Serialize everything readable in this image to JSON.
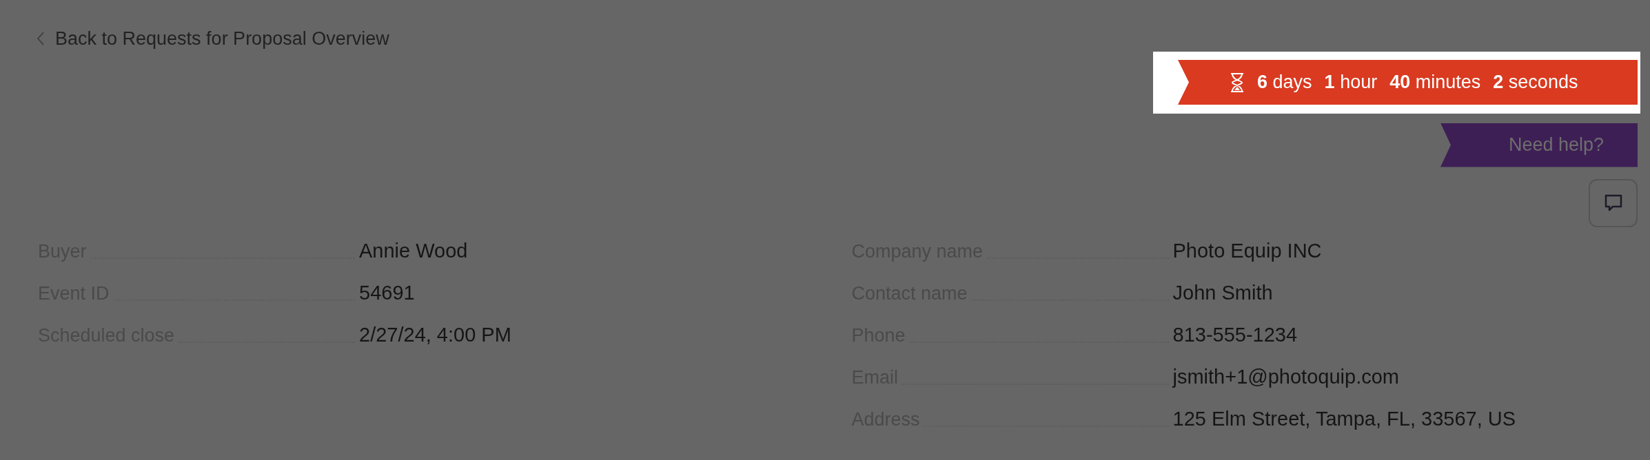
{
  "back_link": {
    "label": "Back to Requests for Proposal Overview"
  },
  "countdown": {
    "segments": [
      {
        "value": "6",
        "unit": "days"
      },
      {
        "value": "1",
        "unit": "hour"
      },
      {
        "value": "40",
        "unit": "minutes"
      },
      {
        "value": "2",
        "unit": "seconds"
      }
    ]
  },
  "help_button": {
    "label": "Need help?"
  },
  "event_details": [
    {
      "label": "Buyer",
      "value": "Annie Wood"
    },
    {
      "label": "Event ID",
      "value": "54691"
    },
    {
      "label": "Scheduled close",
      "value": "2/27/24, 4:00 PM"
    }
  ],
  "supplier_details": [
    {
      "label": "Company name",
      "value": "Photo Equip INC"
    },
    {
      "label": "Contact name",
      "value": "John Smith"
    },
    {
      "label": "Phone",
      "value": "813-555-1234"
    },
    {
      "label": "Email",
      "value": "jsmith+1@photoquip.com"
    },
    {
      "label": "Address",
      "value": "125 Elm Street, Tampa, FL, 33567, US"
    }
  ]
}
